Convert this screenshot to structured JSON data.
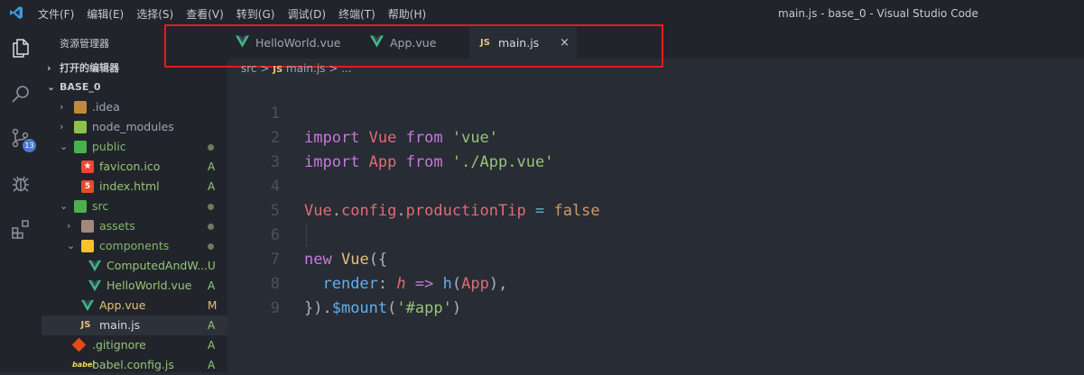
{
  "titlebar": {
    "menu": [
      "文件(F)",
      "编辑(E)",
      "选择(S)",
      "查看(V)",
      "转到(G)",
      "调试(D)",
      "终端(T)",
      "帮助(H)"
    ],
    "window_title": "main.js - base_0 - Visual Studio Code"
  },
  "activity": {
    "icons": [
      "explorer-icon",
      "search-icon",
      "source-control-icon",
      "debug-icon",
      "extensions-icon"
    ],
    "scm_badge": "13"
  },
  "sidebar": {
    "title": "资源管理器",
    "open_editors": "打开的编辑器",
    "project": "BASE_0",
    "tree": [
      {
        "name": ".idea",
        "status": "",
        "dot": false
      },
      {
        "name": "node_modules",
        "status": "",
        "dot": false
      },
      {
        "name": "public",
        "status": "",
        "dot": true
      },
      {
        "name": "favicon.ico",
        "status": "A",
        "dot": false
      },
      {
        "name": "index.html",
        "status": "A",
        "dot": false
      },
      {
        "name": "src",
        "status": "",
        "dot": true
      },
      {
        "name": "assets",
        "status": "",
        "dot": true
      },
      {
        "name": "components",
        "status": "",
        "dot": true
      },
      {
        "name": "ComputedAndW...",
        "status": "U",
        "dot": false
      },
      {
        "name": "HelloWorld.vue",
        "status": "A",
        "dot": false
      },
      {
        "name": "App.vue",
        "status": "M",
        "dot": false
      },
      {
        "name": "main.js",
        "status": "A",
        "dot": false
      },
      {
        "name": ".gitignore",
        "status": "A",
        "dot": false
      },
      {
        "name": "babel.config.js",
        "status": "A",
        "dot": false
      }
    ]
  },
  "tabs": [
    {
      "label": "HelloWorld.vue"
    },
    {
      "label": "App.vue"
    },
    {
      "label": "main.js",
      "close": "×",
      "js_badge": "JS"
    }
  ],
  "breadcrumb": {
    "folder": "src",
    "sep": ">",
    "file_badge": "JS",
    "file": "main.js",
    "more": "..."
  },
  "editor": {
    "line_numbers": [
      "1",
      "2",
      "3",
      "4",
      "5",
      "6",
      "7",
      "8",
      "9"
    ],
    "tokens": {
      "import": "import",
      "from": "from",
      "Vue": "Vue",
      "vue_str": "'vue'",
      "App": "App",
      "app_str": "'./App.vue'",
      "config": "config",
      "productionTip": "productionTip",
      "eq": "=",
      "false": "false",
      "new": "new",
      "open_call": "({",
      "render": "render",
      "colon": ":",
      "h": "h",
      "arrow": "=>",
      "h_call": "h",
      "paren_open": "(",
      "paren_close_comma": "),",
      "close_call": "}).",
      "mount": "$mount",
      "app_sel": "'#app'",
      "paren_close": ")",
      "dot": "."
    },
    "colors": {
      "keyword": "#c678dd",
      "identifier": "#e06c75",
      "string": "#98c379",
      "function": "#61afef",
      "operator": "#56b6c2"
    }
  },
  "colors": {
    "highlight": "#e21c1c",
    "vue_green": "#41b883",
    "js_yellow": "#e5c07b",
    "editor_bg": "#282c34"
  }
}
